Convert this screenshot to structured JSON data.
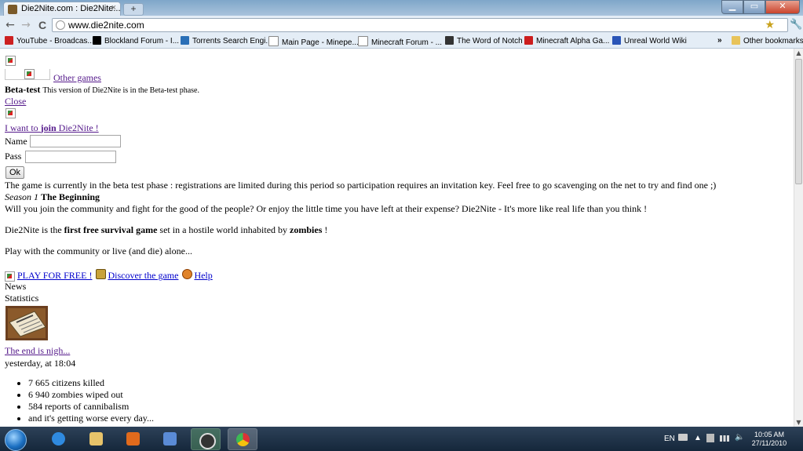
{
  "browser": {
    "tab_title": "Die2Nite.com : Die2Nite....",
    "tab_close": "×",
    "new_tab": "+",
    "url": "www.die2nite.com",
    "window_min": "▁",
    "window_max": "▭",
    "window_close": "✕",
    "nav": {
      "back": "←",
      "forward": "→",
      "reload": "C"
    },
    "bookmarks": [
      {
        "label": "YouTube - Broadcas...",
        "icon": "youtube-icon",
        "color": "#cc2020"
      },
      {
        "label": "Blockland Forum - I...",
        "icon": "blockland-icon",
        "color": "#000000"
      },
      {
        "label": "Torrents Search Engi...",
        "icon": "torrents-icon",
        "color": "#2a6fb7"
      },
      {
        "label": "Main Page - Minepe...",
        "icon": "page-icon",
        "color": "#ffffff"
      },
      {
        "label": "Minecraft Forum - ...",
        "icon": "page-icon",
        "color": "#ffffff"
      },
      {
        "label": "The Word of Notch",
        "icon": "notch-icon",
        "color": "#333333"
      },
      {
        "label": "Minecraft Alpha Ga...",
        "icon": "minecraft-icon",
        "color": "#cc1d1d"
      },
      {
        "label": "Unreal World Wiki",
        "icon": "wiki-icon",
        "color": "#2a55b7"
      }
    ],
    "bookmarks_overflow": "»",
    "other_bookmarks": "Other bookmarks"
  },
  "page": {
    "other_games": "Other games",
    "beta_title": "Beta-test",
    "beta_text": "This version of Die2Nite is in the Beta-test phase.",
    "close": "Close",
    "join_prefix": "I want to ",
    "join_bold": "join",
    "join_suffix": " Die2Nite !",
    "name_label": "Name",
    "pass_label": "Pass",
    "ok_button": "Ok",
    "beta_notice": "The game is currently in the beta test phase : registrations are limited during this period so participation requires an invitation key. Feel free to go scavenging on the net to try and find one ;)",
    "season_label": "Season 1",
    "season_title": "The Beginning",
    "intro": "Will you join the community and fight for the good of the people? Or enjoy the little time you have left at their expense? Die2Nite - It's more like real life than you think !",
    "desc_prefix": "Die2Nite is the ",
    "desc_bold1": "first free survival game",
    "desc_mid": " set in a hostile world inhabited by ",
    "desc_bold2": "zombies",
    "desc_suffix": " !",
    "play_line": "Play with the community or live (and die) alone...",
    "play_link": "PLAY FOR FREE !",
    "discover_link": "Discover the game",
    "help_link": "Help",
    "news_label": "News",
    "statistics_label": "Statistics",
    "news_headline": "The end is nigh...",
    "news_time": "yesterday, at 18:04",
    "stats": [
      "7 665 citizens killed",
      "6 940 zombies wiped out",
      "584 reports of cannibalism",
      "and it's getting worse every day..."
    ]
  },
  "taskbar": {
    "language": "EN",
    "time": "10:05 AM",
    "date": "27/11/2010"
  }
}
